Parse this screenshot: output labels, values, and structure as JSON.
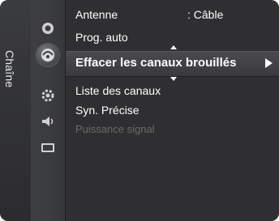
{
  "side_tab": {
    "label": "Chaîne"
  },
  "icons": [
    "satellite-dish-icon",
    "channel-icon-active",
    "gear-icon",
    "sound-icon",
    "input-icon"
  ],
  "menu": {
    "antenne_label": "Antenne",
    "antenne_value": ": Câble",
    "prog_auto": "Prog. auto",
    "effacer": "Effacer les canaux brouillés",
    "liste": "Liste des canaux",
    "syn": "Syn. Précise",
    "puissance": "Puissance signal"
  },
  "colors": {
    "panel": "#2f2f31",
    "text": "#ffffff",
    "disabled_text": "#6b6b6b",
    "highlight": "#4a4a4d"
  }
}
